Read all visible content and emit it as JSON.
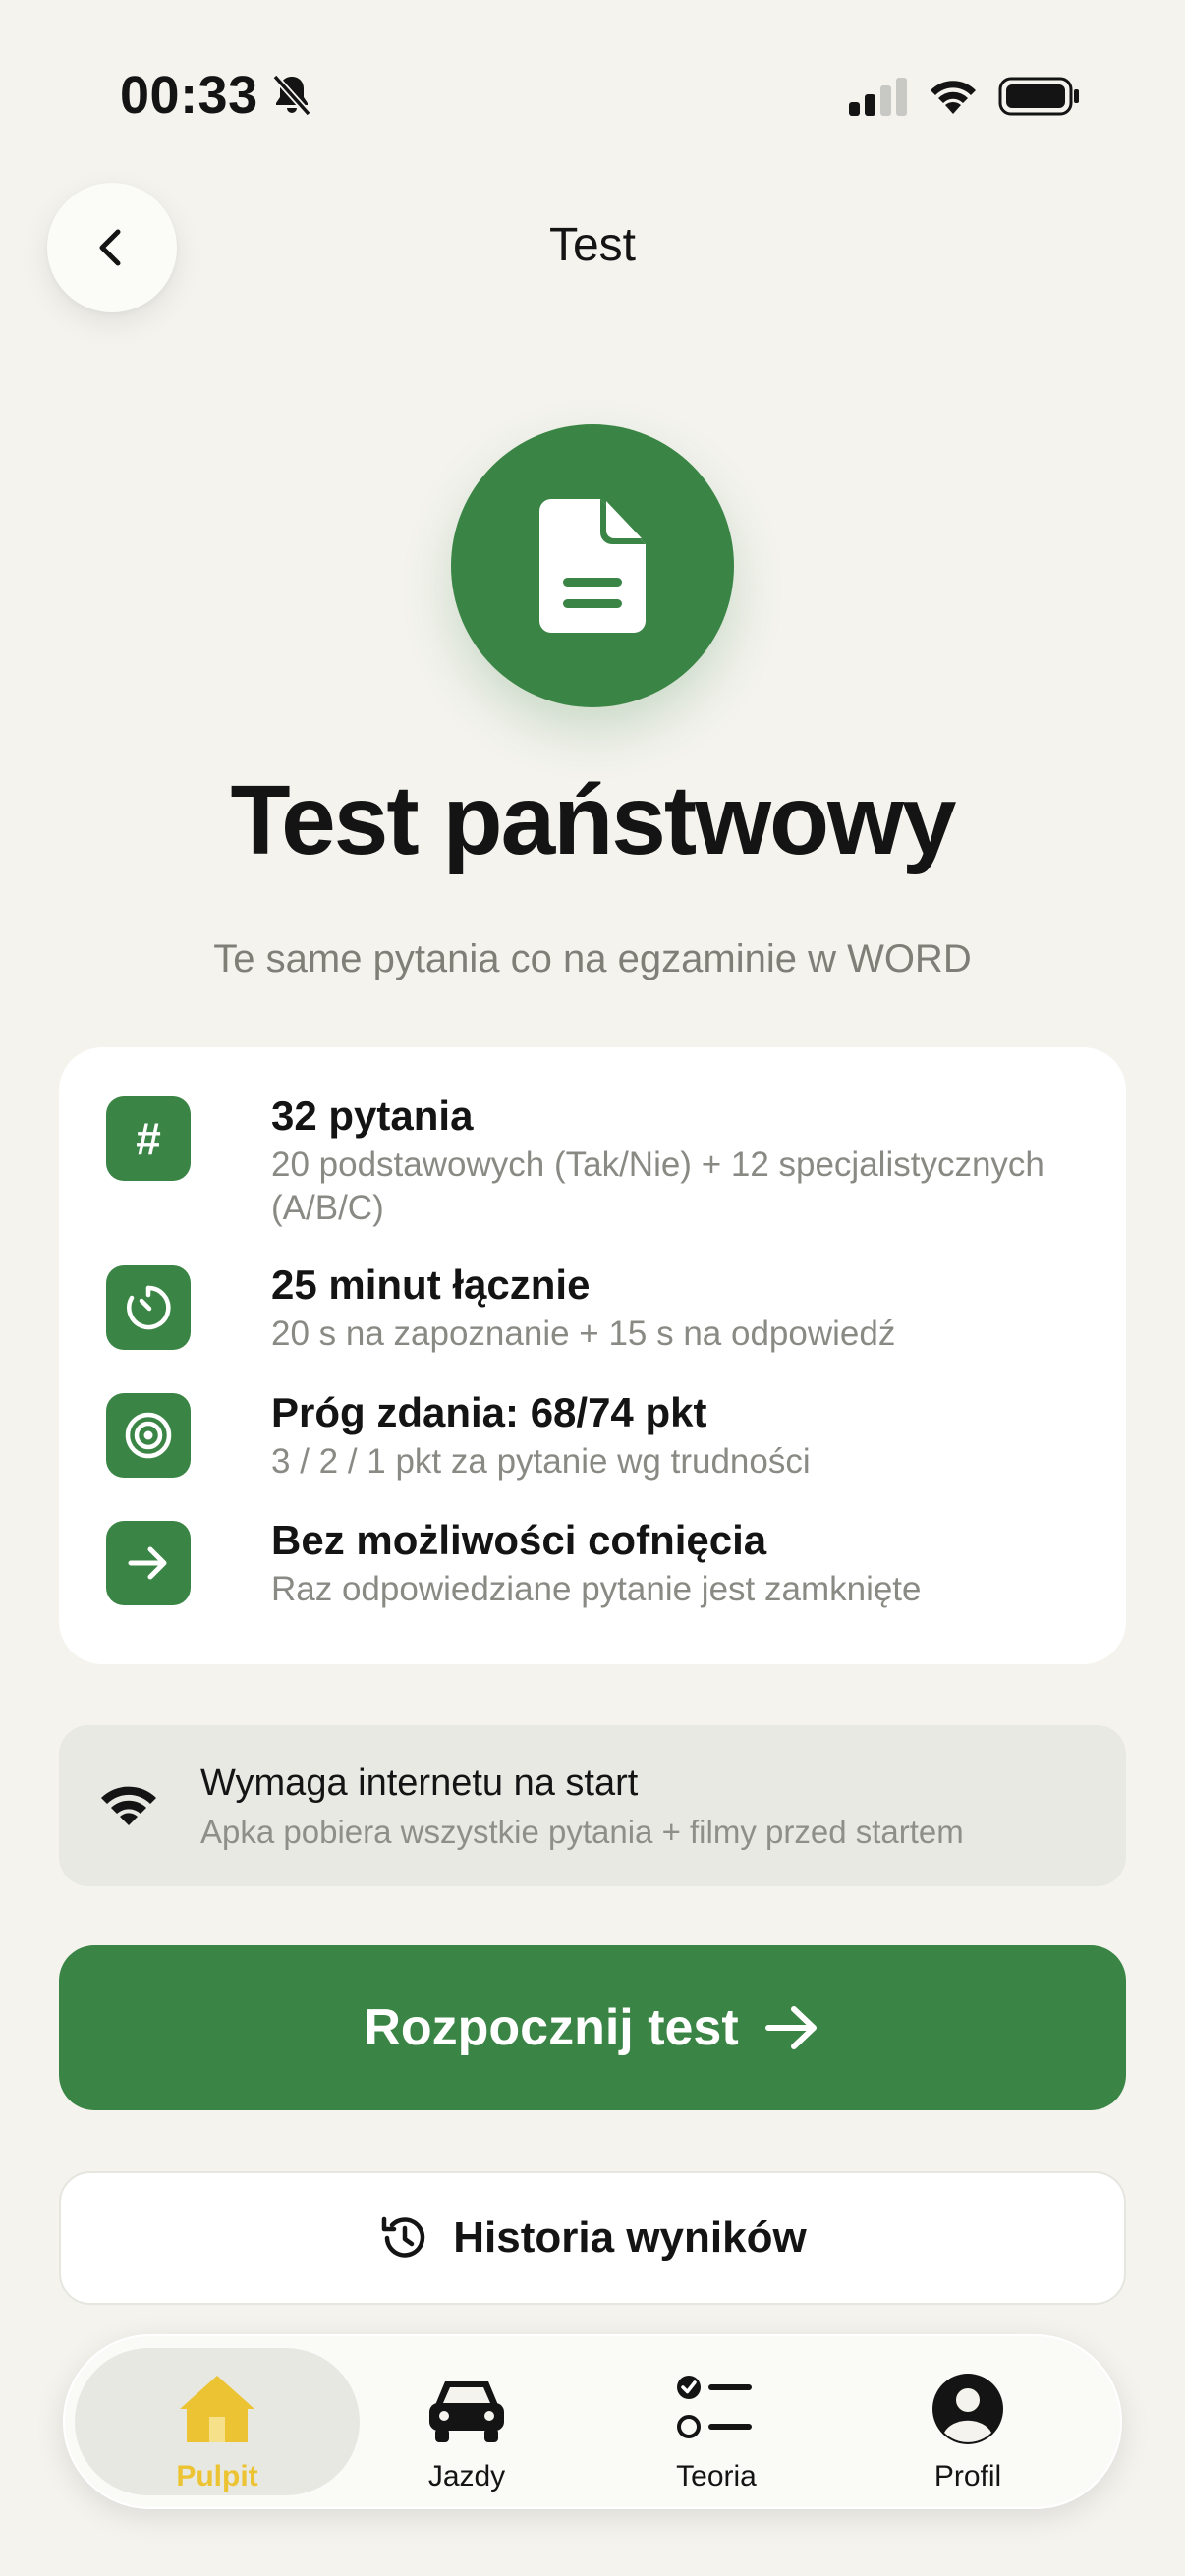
{
  "status_bar": {
    "time": "00:33",
    "icons": [
      "bell-slash-icon",
      "cellular-signal-icon",
      "wifi-icon",
      "battery-icon"
    ]
  },
  "header": {
    "title": "Test",
    "back_icon": "chevron-left-icon"
  },
  "hero": {
    "icon": "document-icon",
    "title": "Test państwowy",
    "subtitle": "Te same pytania co na egzaminie w WORD"
  },
  "info_items": [
    {
      "icon": "hash-icon",
      "title": "32 pytania",
      "description": "20 podstawowych (Tak/Nie) + 12 specjalistycznych (A/B/C)"
    },
    {
      "icon": "timer-icon",
      "title": "25 minut łącznie",
      "description": "20 s na zapoznanie + 15 s na odpowiedź"
    },
    {
      "icon": "target-icon",
      "title": "Próg zdania: 68/74 pkt",
      "description": "3 / 2 / 1 pkt za pytanie wg trudności"
    },
    {
      "icon": "arrow-right-icon",
      "title": "Bez możliwości cofnięcia",
      "description": "Raz odpowiedziane pytanie jest zamknięte"
    }
  ],
  "notice": {
    "icon": "wifi-icon",
    "title": "Wymaga internetu na start",
    "description": "Apka pobiera wszystkie pytania + filmy przed startem"
  },
  "start_button": {
    "label": "Rozpocznij test",
    "icon": "arrow-right-icon"
  },
  "history_button": {
    "label": "Historia wyników",
    "icon": "history-icon"
  },
  "tab_bar": {
    "tabs": [
      {
        "label": "Pulpit",
        "icon": "home-icon",
        "active": true
      },
      {
        "label": "Jazdy",
        "icon": "car-icon",
        "active": false
      },
      {
        "label": "Teoria",
        "icon": "checklist-icon",
        "active": false
      },
      {
        "label": "Profil",
        "icon": "person-icon",
        "active": false
      }
    ]
  },
  "colors": {
    "background": "#f4f3ee",
    "accent_green": "#3a8545",
    "active_tab_yellow": "#ecc433",
    "muted_text": "#8a8a85"
  }
}
